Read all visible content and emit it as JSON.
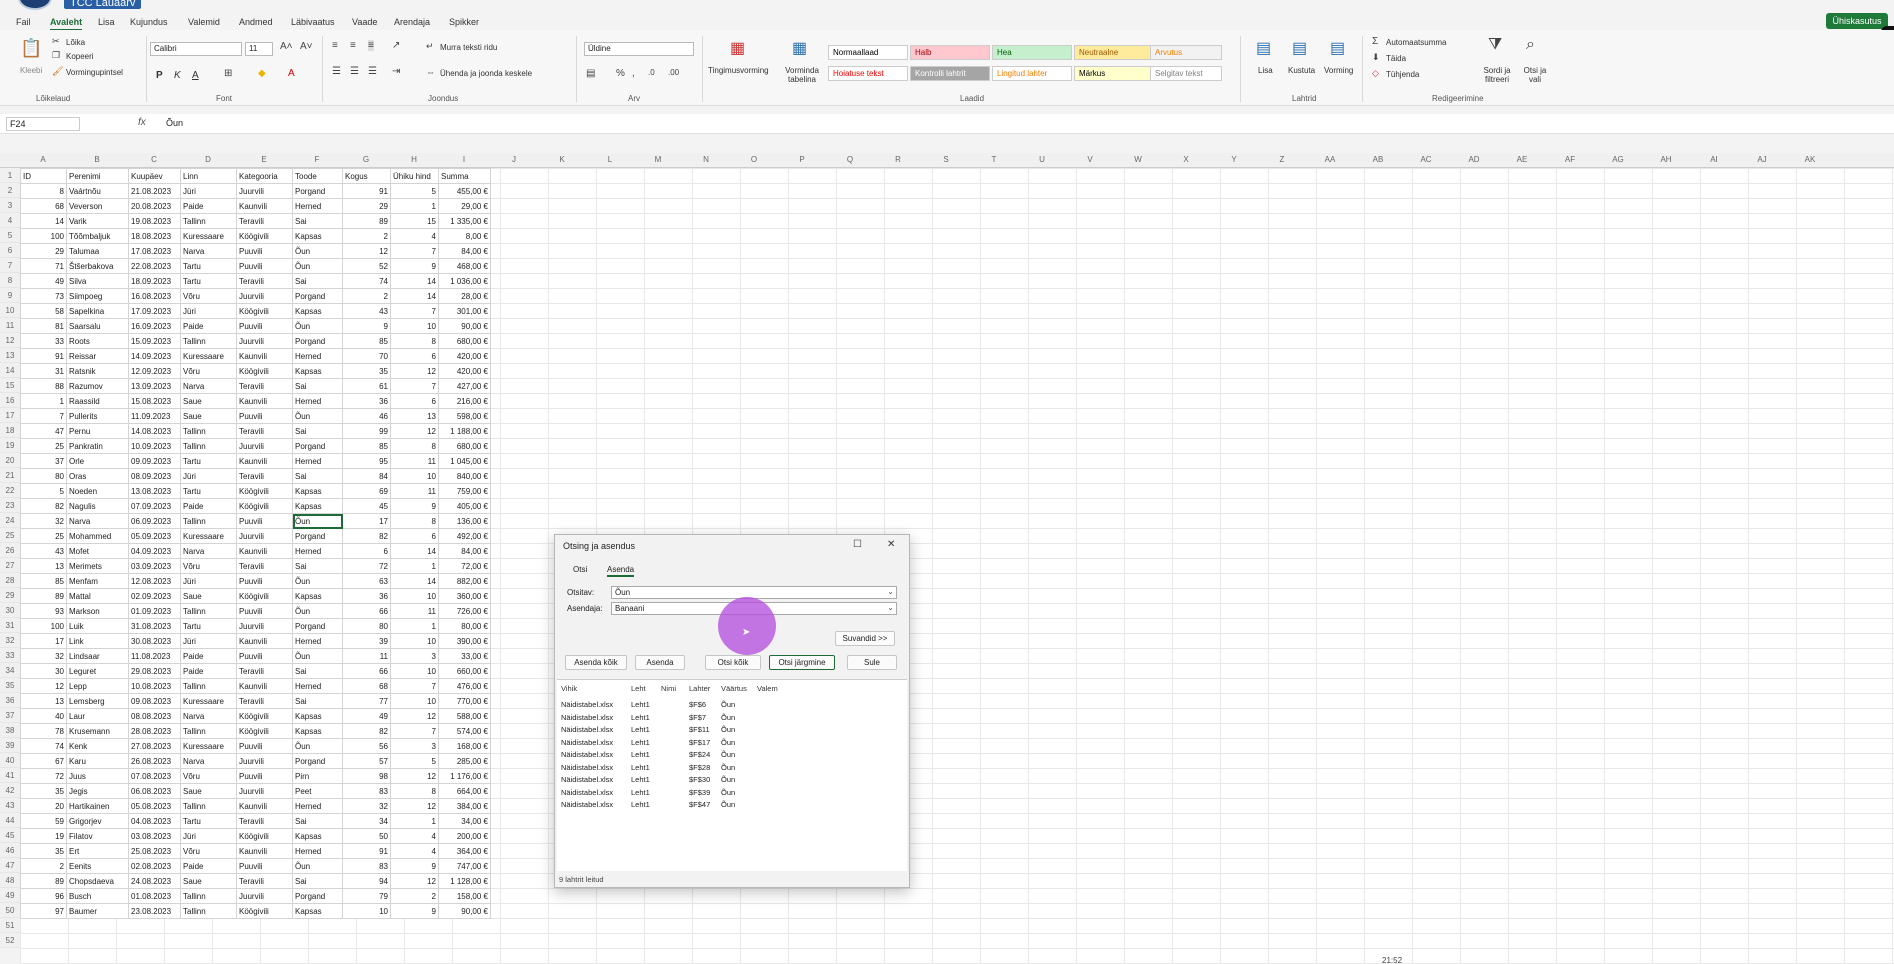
{
  "window": {
    "title": "TCC Lauaarv",
    "share_label": "Ühiskasutus"
  },
  "menu": {
    "items": [
      "Fail",
      "Avaleht",
      "Lisa",
      "Kujundus",
      "Valemid",
      "Andmed",
      "Läbivaatus",
      "Vaade",
      "Arendaja",
      "Spikker"
    ],
    "active": "Avaleht"
  },
  "ribbon": {
    "clipboard": {
      "paste": "Kleebi",
      "cut": "Lõika",
      "copy": "Kopeeri",
      "painter": "Vormingupintsel",
      "group": "Lõikelaud"
    },
    "font": {
      "name": "Calibri",
      "size": "11",
      "group": "Font",
      "bold": "P",
      "italic": "K",
      "underline": "A"
    },
    "alignment": {
      "wrap": "Murra teksti ridu",
      "merge": "Ühenda ja joonda keskele",
      "group": "Joondus"
    },
    "number": {
      "format": "Üldine",
      "group": "Arv"
    },
    "styles": {
      "conditional": "Tingimusvorming",
      "table": "Vorminda tabelina",
      "group": "Laadid",
      "cells": [
        {
          "label": "Normaallaad",
          "bg": "#ffffff",
          "fg": "#000000"
        },
        {
          "label": "Halb",
          "bg": "#ffc7ce",
          "fg": "#9c0006"
        },
        {
          "label": "Hea",
          "bg": "#c6efce",
          "fg": "#006100"
        },
        {
          "label": "Neutraalne",
          "bg": "#ffeb9c",
          "fg": "#9c5700"
        },
        {
          "label": "Arvutus",
          "bg": "#f2f2f2",
          "fg": "#fa7d00"
        },
        {
          "label": "Hoiatuse tekst",
          "bg": "#ffffff",
          "fg": "#ff0000"
        },
        {
          "label": "Kontrolli lahtrit",
          "bg": "#a5a5a5",
          "fg": "#ffffff"
        },
        {
          "label": "Lingitud lahter",
          "bg": "#ffffff",
          "fg": "#fa7d00"
        },
        {
          "label": "Märkus",
          "bg": "#ffffcc",
          "fg": "#000000"
        },
        {
          "label": "Selgitav tekst",
          "bg": "#ffffff",
          "fg": "#7f7f7f"
        }
      ]
    },
    "cells": {
      "insert": "Lisa",
      "delete": "Kustuta",
      "format": "Vorming",
      "group": "Lahtrid"
    },
    "editing": {
      "autosum": "Automaatsumma",
      "fill": "Täida",
      "clear": "Tühjenda",
      "sort": "Sordi ja filtreeri",
      "find": "Otsi ja vali",
      "group": "Redigeerimine"
    }
  },
  "formula_bar": {
    "name_box": "F24",
    "fx": "fx",
    "value": "Õun"
  },
  "columns": [
    "A",
    "B",
    "C",
    "D",
    "E",
    "F",
    "G",
    "H",
    "I",
    "J",
    "K",
    "L",
    "M",
    "N",
    "O",
    "P",
    "Q",
    "R",
    "S",
    "T",
    "U",
    "V",
    "W",
    "X",
    "Y",
    "Z",
    "AA",
    "AB",
    "AC",
    "AD",
    "AE",
    "AF",
    "AG",
    "AH",
    "AI",
    "AJ",
    "AK"
  ],
  "row_count": 52,
  "sheet": {
    "header": [
      "ID",
      "Perenimi",
      "Kuupäev",
      "Linn",
      "Kategooria",
      "Toode",
      "Kogus",
      "Ühiku hind",
      "Summa"
    ],
    "rows": [
      [
        "8",
        "Vaártnõu",
        "21.08.2023",
        "Jüri",
        "Juurvili",
        "Porgand",
        "91",
        "5",
        "455,00 €"
      ],
      [
        "68",
        "Veverson",
        "20.08.2023",
        "Paide",
        "Kaunvili",
        "Herned",
        "29",
        "1",
        "29,00 €"
      ],
      [
        "14",
        "Varik",
        "19.08.2023",
        "Tallinn",
        "Teravili",
        "Sai",
        "89",
        "15",
        "1 335,00 €"
      ],
      [
        "100",
        "Tõõmbaljuk",
        "18.08.2023",
        "Kuressaare",
        "Köögivili",
        "Kapsas",
        "2",
        "4",
        "8,00 €"
      ],
      [
        "29",
        "Talumaa",
        "17.08.2023",
        "Narva",
        "Puuvili",
        "Õun",
        "12",
        "7",
        "84,00 €"
      ],
      [
        "71",
        "Štšerbakova",
        "22.08.2023",
        "Tartu",
        "Puuvili",
        "Õun",
        "52",
        "9",
        "468,00 €"
      ],
      [
        "49",
        "Silva",
        "18.09.2023",
        "Tartu",
        "Teravili",
        "Sai",
        "74",
        "14",
        "1 036,00 €"
      ],
      [
        "73",
        "Siimpoeg",
        "16.08.2023",
        "Võru",
        "Juurvili",
        "Porgand",
        "2",
        "14",
        "28,00 €"
      ],
      [
        "58",
        "Sapelkina",
        "17.09.2023",
        "Jüri",
        "Köögivili",
        "Kapsas",
        "43",
        "7",
        "301,00 €"
      ],
      [
        "81",
        "Saarsalu",
        "16.09.2023",
        "Paide",
        "Puuvili",
        "Õun",
        "9",
        "10",
        "90,00 €"
      ],
      [
        "33",
        "Roots",
        "15.09.2023",
        "Tallinn",
        "Juurvili",
        "Porgand",
        "85",
        "8",
        "680,00 €"
      ],
      [
        "91",
        "Reissar",
        "14.09.2023",
        "Kuressaare",
        "Kaunvili",
        "Herned",
        "70",
        "6",
        "420,00 €"
      ],
      [
        "31",
        "Ratsnik",
        "12.09.2023",
        "Võru",
        "Köögivili",
        "Kapsas",
        "35",
        "12",
        "420,00 €"
      ],
      [
        "88",
        "Razumov",
        "13.09.2023",
        "Narva",
        "Teravili",
        "Sai",
        "61",
        "7",
        "427,00 €"
      ],
      [
        "1",
        "Raassild",
        "15.08.2023",
        "Saue",
        "Kaunvili",
        "Herned",
        "36",
        "6",
        "216,00 €"
      ],
      [
        "7",
        "Pullerits",
        "11.09.2023",
        "Saue",
        "Puuvili",
        "Õun",
        "46",
        "13",
        "598,00 €"
      ],
      [
        "47",
        "Pernu",
        "14.08.2023",
        "Tallinn",
        "Teravili",
        "Sai",
        "99",
        "12",
        "1 188,00 €"
      ],
      [
        "25",
        "Pankratin",
        "10.09.2023",
        "Tallinn",
        "Juurvili",
        "Porgand",
        "85",
        "8",
        "680,00 €"
      ],
      [
        "37",
        "Orle",
        "09.09.2023",
        "Tartu",
        "Kaunvili",
        "Herned",
        "95",
        "11",
        "1 045,00 €"
      ],
      [
        "80",
        "Oras",
        "08.09.2023",
        "Jüri",
        "Teravili",
        "Sai",
        "84",
        "10",
        "840,00 €"
      ],
      [
        "5",
        "Noeden",
        "13.08.2023",
        "Tartu",
        "Köögivili",
        "Kapsas",
        "69",
        "11",
        "759,00 €"
      ],
      [
        "82",
        "Nagulis",
        "07.09.2023",
        "Paide",
        "Köögivili",
        "Kapsas",
        "45",
        "9",
        "405,00 €"
      ],
      [
        "32",
        "Narva",
        "06.09.2023",
        "Tallinn",
        "Puuvili",
        "Õun",
        "17",
        "8",
        "136,00 €"
      ],
      [
        "25",
        "Mohammed",
        "05.09.2023",
        "Kuressaare",
        "Juurvili",
        "Porgand",
        "82",
        "6",
        "492,00 €"
      ],
      [
        "43",
        "Mofet",
        "04.09.2023",
        "Narva",
        "Kaunvili",
        "Herned",
        "6",
        "14",
        "84,00 €"
      ],
      [
        "13",
        "Merimets",
        "03.09.2023",
        "Võru",
        "Teravili",
        "Sai",
        "72",
        "1",
        "72,00 €"
      ],
      [
        "85",
        "Menfam",
        "12.08.2023",
        "Jüri",
        "Puuvili",
        "Õun",
        "63",
        "14",
        "882,00 €"
      ],
      [
        "89",
        "Mattal",
        "02.09.2023",
        "Saue",
        "Köögivili",
        "Kapsas",
        "36",
        "10",
        "360,00 €"
      ],
      [
        "93",
        "Markson",
        "01.09.2023",
        "Tallinn",
        "Puuvili",
        "Õun",
        "66",
        "11",
        "726,00 €"
      ],
      [
        "100",
        "Luik",
        "31.08.2023",
        "Tartu",
        "Juurvili",
        "Porgand",
        "80",
        "1",
        "80,00 €"
      ],
      [
        "17",
        "Link",
        "30.08.2023",
        "Jüri",
        "Kaunvili",
        "Herned",
        "39",
        "10",
        "390,00 €"
      ],
      [
        "32",
        "Lindsaar",
        "11.08.2023",
        "Paide",
        "Puuvili",
        "Õun",
        "11",
        "3",
        "33,00 €"
      ],
      [
        "30",
        "Leguret",
        "29.08.2023",
        "Paide",
        "Teravili",
        "Sai",
        "66",
        "10",
        "660,00 €"
      ],
      [
        "12",
        "Lepp",
        "10.08.2023",
        "Tallinn",
        "Kaunvili",
        "Herned",
        "68",
        "7",
        "476,00 €"
      ],
      [
        "13",
        "Lemsberg",
        "09.08.2023",
        "Kuressaare",
        "Teravili",
        "Sai",
        "77",
        "10",
        "770,00 €"
      ],
      [
        "40",
        "Laur",
        "08.08.2023",
        "Narva",
        "Köögivili",
        "Kapsas",
        "49",
        "12",
        "588,00 €"
      ],
      [
        "78",
        "Krusemann",
        "28.08.2023",
        "Tallinn",
        "Köögivili",
        "Kapsas",
        "82",
        "7",
        "574,00 €"
      ],
      [
        "74",
        "Kenk",
        "27.08.2023",
        "Kuressaare",
        "Puuvili",
        "Õun",
        "56",
        "3",
        "168,00 €"
      ],
      [
        "67",
        "Karu",
        "26.08.2023",
        "Narva",
        "Juurvili",
        "Porgand",
        "57",
        "5",
        "285,00 €"
      ],
      [
        "72",
        "Juus",
        "07.08.2023",
        "Võru",
        "Puuvili",
        "Pirn",
        "98",
        "12",
        "1 176,00 €"
      ],
      [
        "35",
        "Jegis",
        "06.08.2023",
        "Saue",
        "Juurvili",
        "Peet",
        "83",
        "8",
        "664,00 €"
      ],
      [
        "20",
        "Hartikainen",
        "05.08.2023",
        "Tallinn",
        "Kaunvili",
        "Herned",
        "32",
        "12",
        "384,00 €"
      ],
      [
        "59",
        "Grigorjev",
        "04.08.2023",
        "Tartu",
        "Teravili",
        "Sai",
        "34",
        "1",
        "34,00 €"
      ],
      [
        "19",
        "Filatov",
        "03.08.2023",
        "Jüri",
        "Köögivili",
        "Kapsas",
        "50",
        "4",
        "200,00 €"
      ],
      [
        "35",
        "Ert",
        "25.08.2023",
        "Võru",
        "Kaunvili",
        "Herned",
        "91",
        "4",
        "364,00 €"
      ],
      [
        "2",
        "Eenits",
        "02.08.2023",
        "Paide",
        "Puuvili",
        "Õun",
        "83",
        "9",
        "747,00 €"
      ],
      [
        "89",
        "Chopsdaeva",
        "24.08.2023",
        "Saue",
        "Teravili",
        "Sai",
        "94",
        "12",
        "1 128,00 €"
      ],
      [
        "96",
        "Busch",
        "01.08.2023",
        "Tallinn",
        "Juurvili",
        "Porgand",
        "79",
        "2",
        "158,00 €"
      ],
      [
        "97",
        "Baumer",
        "23.08.2023",
        "Tallinn",
        "Köögivili",
        "Kapsas",
        "10",
        "9",
        "90,00 €"
      ]
    ]
  },
  "dialog": {
    "title": "Otsing ja asendus",
    "tabs": [
      "Otsi",
      "Asenda"
    ],
    "find_label": "Otsitav:",
    "find_value": "Õun",
    "replace_label": "Asendaja:",
    "replace_value": "Banaani",
    "options_btn": "Suvandid >>",
    "buttons": [
      "Asenda kõik",
      "Asenda",
      "Otsi kõik",
      "Otsi järgmine",
      "Sule"
    ],
    "result_headers": [
      "Vihik",
      "Leht",
      "Nimi",
      "Lahter",
      "Väärtus",
      "Valem"
    ],
    "results": [
      [
        "Näidistabel.xlsx",
        "Leht1",
        "",
        "$F$6",
        "Õun"
      ],
      [
        "Näidistabel.xlsx",
        "Leht1",
        "",
        "$F$7",
        "Õun"
      ],
      [
        "Näidistabel.xlsx",
        "Leht1",
        "",
        "$F$11",
        "Õun"
      ],
      [
        "Näidistabel.xlsx",
        "Leht1",
        "",
        "$F$17",
        "Õun"
      ],
      [
        "Näidistabel.xlsx",
        "Leht1",
        "",
        "$F$24",
        "Õun"
      ],
      [
        "Näidistabel.xlsx",
        "Leht1",
        "",
        "$F$28",
        "Õun"
      ],
      [
        "Näidistabel.xlsx",
        "Leht1",
        "",
        "$F$30",
        "Õun"
      ],
      [
        "Näidistabel.xlsx",
        "Leht1",
        "",
        "$F$39",
        "Õun"
      ],
      [
        "Näidistabel.xlsx",
        "Leht1",
        "",
        "$F$47",
        "Õun"
      ]
    ],
    "status": "9 lahtrit leitud"
  },
  "clock": "21:52"
}
